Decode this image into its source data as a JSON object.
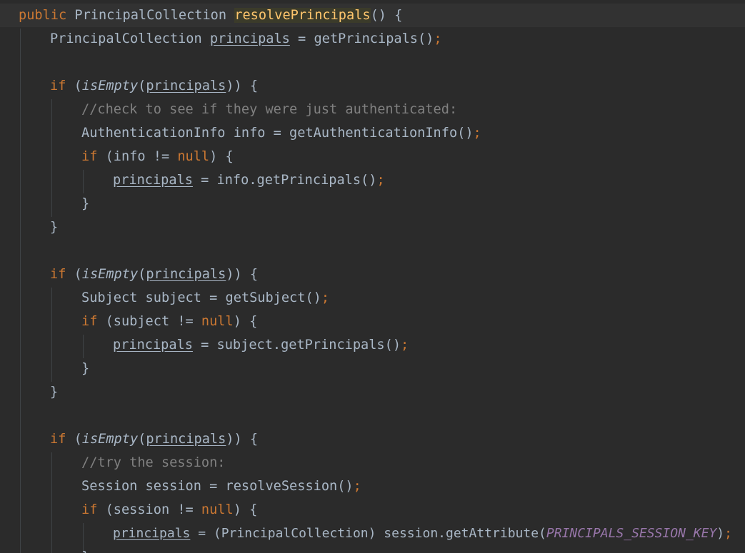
{
  "editor": {
    "theme_colors": {
      "background": "#2b2b2b",
      "keyword": "#cc7832",
      "text": "#a9b7c6",
      "comment": "#808080",
      "method_declaration": "#ffc66d",
      "constant": "#9876aa"
    },
    "code": {
      "l1": {
        "kw": "public",
        "type": "PrincipalCollection",
        "name": "resolvePrincipals",
        "rest": "() {"
      },
      "l2": {
        "type": "PrincipalCollection",
        "var": "principals",
        "eq": " = getPrincipals()",
        "semi": ";"
      },
      "b1_if": {
        "kw": "if",
        "open": " (",
        "call": "isEmpty",
        "p1": "(",
        "arg": "principals",
        "close": ")) {"
      },
      "b1_c1": "//check to see if they were just authenticated:",
      "b1_l2": {
        "text": "AuthenticationInfo info = getAuthenticationInfo()",
        "semi": ";"
      },
      "b1_if2": {
        "kw": "if",
        "a": " (info != ",
        "null": "null",
        "b": ") {"
      },
      "b1_assign": {
        "var": "principals",
        "rest": " = info.getPrincipals()",
        "semi": ";"
      },
      "close_brace": "}",
      "b2_if": {
        "kw": "if",
        "open": " (",
        "call": "isEmpty",
        "p1": "(",
        "arg": "principals",
        "close": ")) {"
      },
      "b2_l1": {
        "text": "Subject subject = getSubject()",
        "semi": ";"
      },
      "b2_if2": {
        "kw": "if",
        "a": " (subject != ",
        "null": "null",
        "b": ") {"
      },
      "b2_assign": {
        "var": "principals",
        "rest": " = subject.getPrincipals()",
        "semi": ";"
      },
      "b3_if": {
        "kw": "if",
        "open": " (",
        "call": "isEmpty",
        "p1": "(",
        "arg": "principals",
        "close": ")) {"
      },
      "b3_c1": "//try the session:",
      "b3_l2": {
        "text": "Session session = resolveSession()",
        "semi": ";"
      },
      "b3_if2": {
        "kw": "if",
        "a": " (session != ",
        "null": "null",
        "b": ") {"
      },
      "b3_assign": {
        "var": "principals",
        "rest": " = (PrincipalCollection) session.getAttribute(",
        "const": "PRINCIPALS_SESSION_KEY",
        "end": ")",
        "semi": ";"
      }
    }
  }
}
